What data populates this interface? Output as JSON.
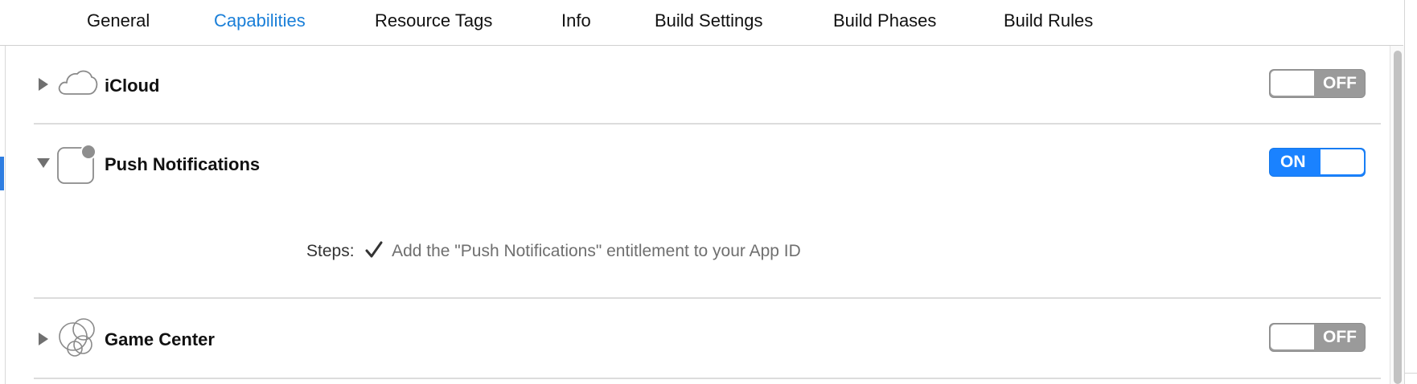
{
  "tabs": [
    "General",
    "Capabilities",
    "Resource Tags",
    "Info",
    "Build Settings",
    "Build Phases",
    "Build Rules"
  ],
  "active_tab": "Capabilities",
  "capabilities": [
    {
      "title": "iCloud",
      "icon": "cloud-icon",
      "expanded": false,
      "state": "OFF"
    },
    {
      "title": "Push Notifications",
      "icon": "push-notifications-icon",
      "expanded": true,
      "state": "ON"
    },
    {
      "title": "Game Center",
      "icon": "game-center-icon",
      "expanded": false,
      "state": "OFF"
    }
  ],
  "push_steps": {
    "label": "Steps:",
    "check_icon": "checkmark-icon",
    "text": "Add the \"Push Notifications\" entitlement to your App ID"
  },
  "colors": {
    "accent": "#1a82ff",
    "active_tab": "#1a7fd8",
    "switch_off": "#9a9a9a"
  }
}
